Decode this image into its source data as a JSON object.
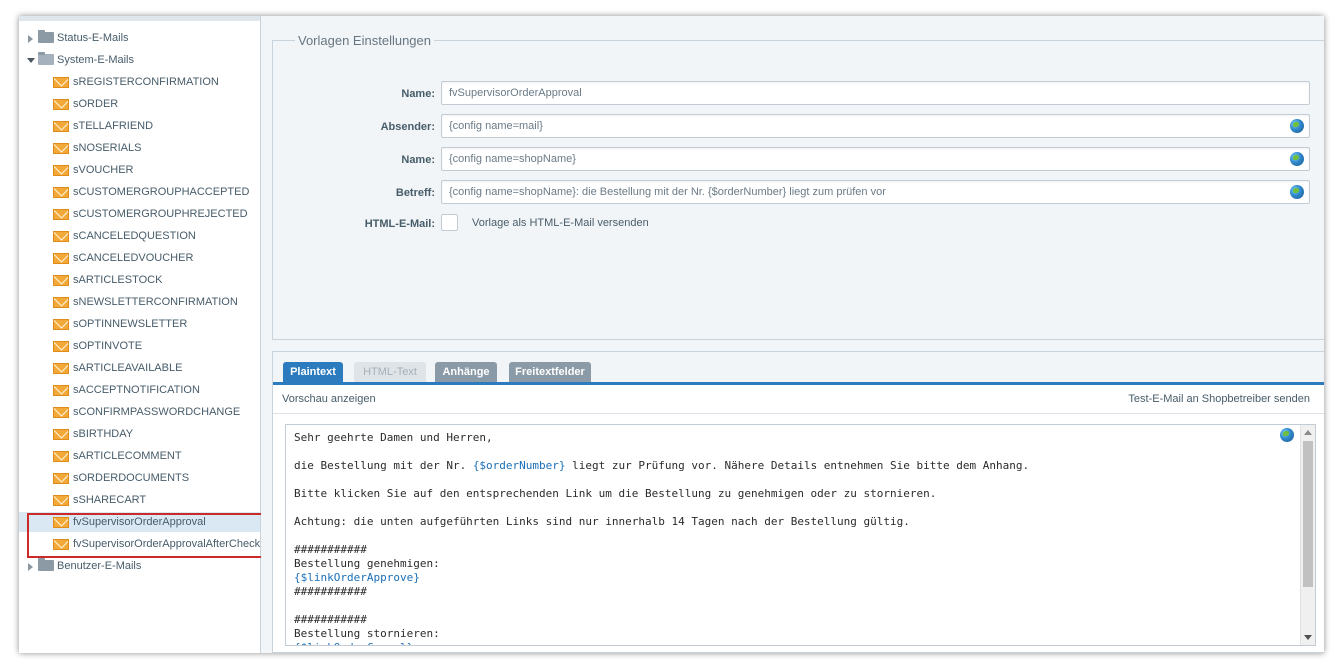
{
  "tree": {
    "groups": [
      {
        "label": "Status-E-Mails"
      },
      {
        "label": "System-E-Mails"
      },
      {
        "label": "Benutzer-E-Mails"
      }
    ],
    "items": [
      "sREGISTERCONFIRMATION",
      "sORDER",
      "sTELLAFRIEND",
      "sNOSERIALS",
      "sVOUCHER",
      "sCUSTOMERGROUPHACCEPTED",
      "sCUSTOMERGROUPHREJECTED",
      "sCANCELEDQUESTION",
      "sCANCELEDVOUCHER",
      "sARTICLESTOCK",
      "sNEWSLETTERCONFIRMATION",
      "sOPTINNEWSLETTER",
      "sOPTINVOTE",
      "sARTICLEAVAILABLE",
      "sACCEPTNOTIFICATION",
      "sCONFIRMPASSWORDCHANGE",
      "sBIRTHDAY",
      "sARTICLECOMMENT",
      "sORDERDOCUMENTS",
      "sSHARECART",
      "fvSupervisorOrderApproval",
      "fvSupervisorOrderApprovalAfterCheck"
    ],
    "selected_index": 20
  },
  "settings": {
    "legend": "Vorlagen Einstellungen",
    "name_label": "Name:",
    "name_value": "fvSupervisorOrderApproval",
    "sender_label": "Absender:",
    "sender_value": "{config name=mail}",
    "sender_name_label": "Name:",
    "sender_name_value": "{config name=shopName}",
    "subject_label": "Betreff:",
    "subject_value": "{config name=shopName}: die Bestellung mit der Nr. {$orderNumber} liegt zum prüfen vor",
    "html_label": "HTML-E-Mail:",
    "html_checkbox_text": "Vorlage als HTML-E-Mail versenden",
    "html_checked": false
  },
  "tabs": [
    {
      "label": "Plaintext",
      "state": "active"
    },
    {
      "label": "HTML-Text",
      "state": "disabled"
    },
    {
      "label": "Anhänge",
      "state": "normal"
    },
    {
      "label": "Freitextfelder",
      "state": "normal"
    }
  ],
  "toolbar": {
    "preview": "Vorschau anzeigen",
    "send_test": "Test-E-Mail an Shopbetreiber senden"
  },
  "editor": {
    "lines": [
      "Sehr geehrte Damen und Herren,",
      "",
      "die Bestellung mit der Nr. {$orderNumber} liegt zur Prüfung vor. Nähere Details entnehmen Sie bitte dem Anhang.",
      "",
      "Bitte klicken Sie auf den entsprechenden Link um die Bestellung zu genehmigen oder zu stornieren.",
      "",
      "Achtung: die unten aufgeführten Links sind nur innerhalb 14 Tagen nach der Bestellung gültig.",
      "",
      "###########",
      "Bestellung genehmigen:",
      "{$linkOrderApprove}",
      "###########",
      "",
      "###########",
      "Bestellung stornieren:",
      "{$linkOrderCancel}"
    ]
  }
}
